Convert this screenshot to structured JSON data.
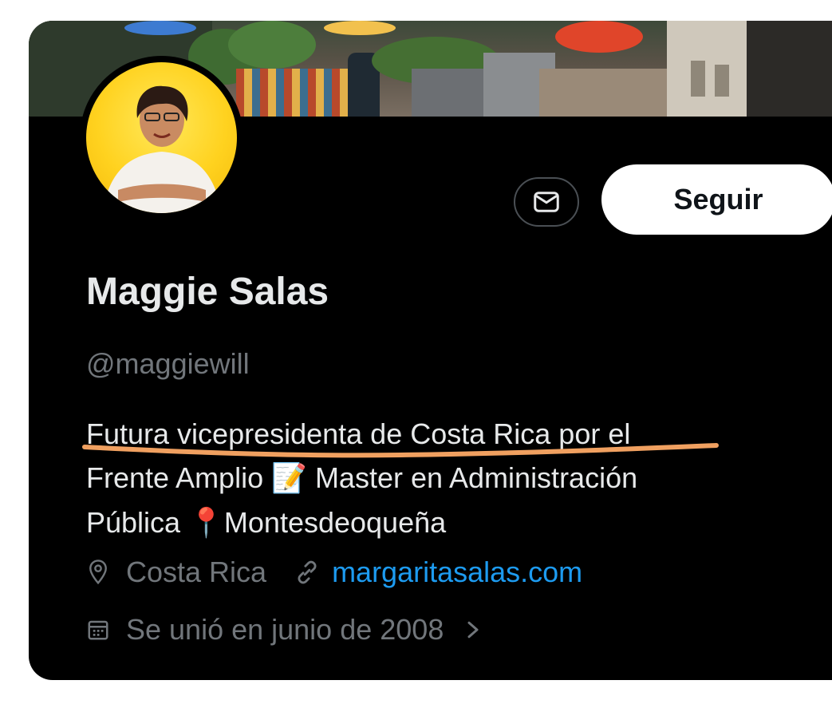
{
  "profile": {
    "name": "Maggie Salas",
    "handle": "@maggiewill",
    "bio": {
      "line1": "Futura vicepresidenta de Costa Rica por el",
      "line2_a": "Frente Amplio ",
      "line2_emoji": "📝",
      "line2_b": " Master en Administración",
      "line3_a": "Pública ",
      "line3_emoji": "📍",
      "line3_b": "Montesdeoqueña"
    },
    "location": "Costa Rica",
    "website": "margaritasalas.com",
    "joined": "Se unió en junio de 2008"
  },
  "actions": {
    "follow_label": "Seguir",
    "message_icon": "envelope-icon"
  },
  "icons": {
    "location": "location-pin-icon",
    "link": "link-icon",
    "calendar": "calendar-icon",
    "chevron": "chevron-right-icon"
  },
  "colors": {
    "background": "#000000",
    "primary_text": "#e7e9ea",
    "secondary_text": "#71767b",
    "link": "#1d9bf0",
    "avatar_bg": "#ffd21f",
    "annotation_underline": "#f0a060"
  }
}
